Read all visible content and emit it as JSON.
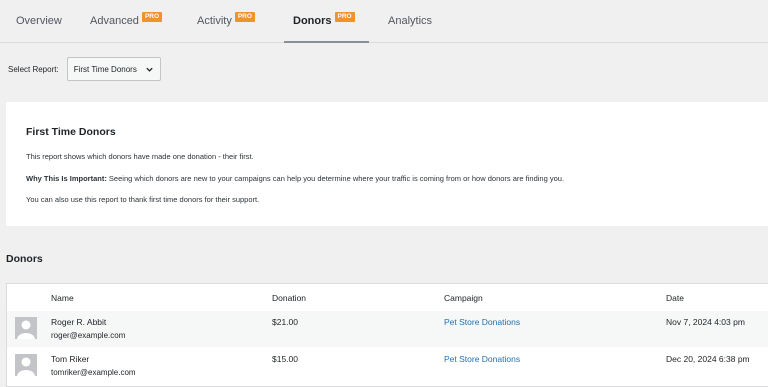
{
  "tabs": [
    {
      "label": "Overview",
      "pro": ""
    },
    {
      "label": "Advanced",
      "pro": "PRO"
    },
    {
      "label": "Activity",
      "pro": "PRO"
    },
    {
      "label": "Donors",
      "pro": "PRO"
    },
    {
      "label": "Analytics",
      "pro": ""
    }
  ],
  "select": {
    "label": "Select Report:",
    "value": "First Time Donors",
    "icon": "chevron-down-icon"
  },
  "info": {
    "title": "First Time Donors",
    "line1": "This report shows which donors have made one donation - their first.",
    "why_label": "Why This Is Important:",
    "why_text": " Seeing which donors are new to your campaigns can help you determine where your traffic is coming from or how donors are finding you.",
    "line3": "You can also use this report to thank first time donors for their support."
  },
  "donors": {
    "title": "Donors",
    "columns": {
      "name": "Name",
      "donation": "Donation",
      "campaign": "Campaign",
      "date": "Date"
    },
    "rows": [
      {
        "name": "Roger R. Abbit",
        "email": "roger@example.com",
        "donation": "$21.00",
        "campaign": "Pet Store Donations",
        "date": "Nov 7, 2024 4:03 pm"
      },
      {
        "name": "Tom Riker",
        "email": "tomriker@example.com",
        "donation": "$15.00",
        "campaign": "Pet Store Donations",
        "date": "Dec 20, 2024 6:38 pm"
      }
    ]
  },
  "colors": {
    "pro_badge": "#f0932b",
    "link": "#2271b1",
    "background": "#f0f0f1"
  }
}
